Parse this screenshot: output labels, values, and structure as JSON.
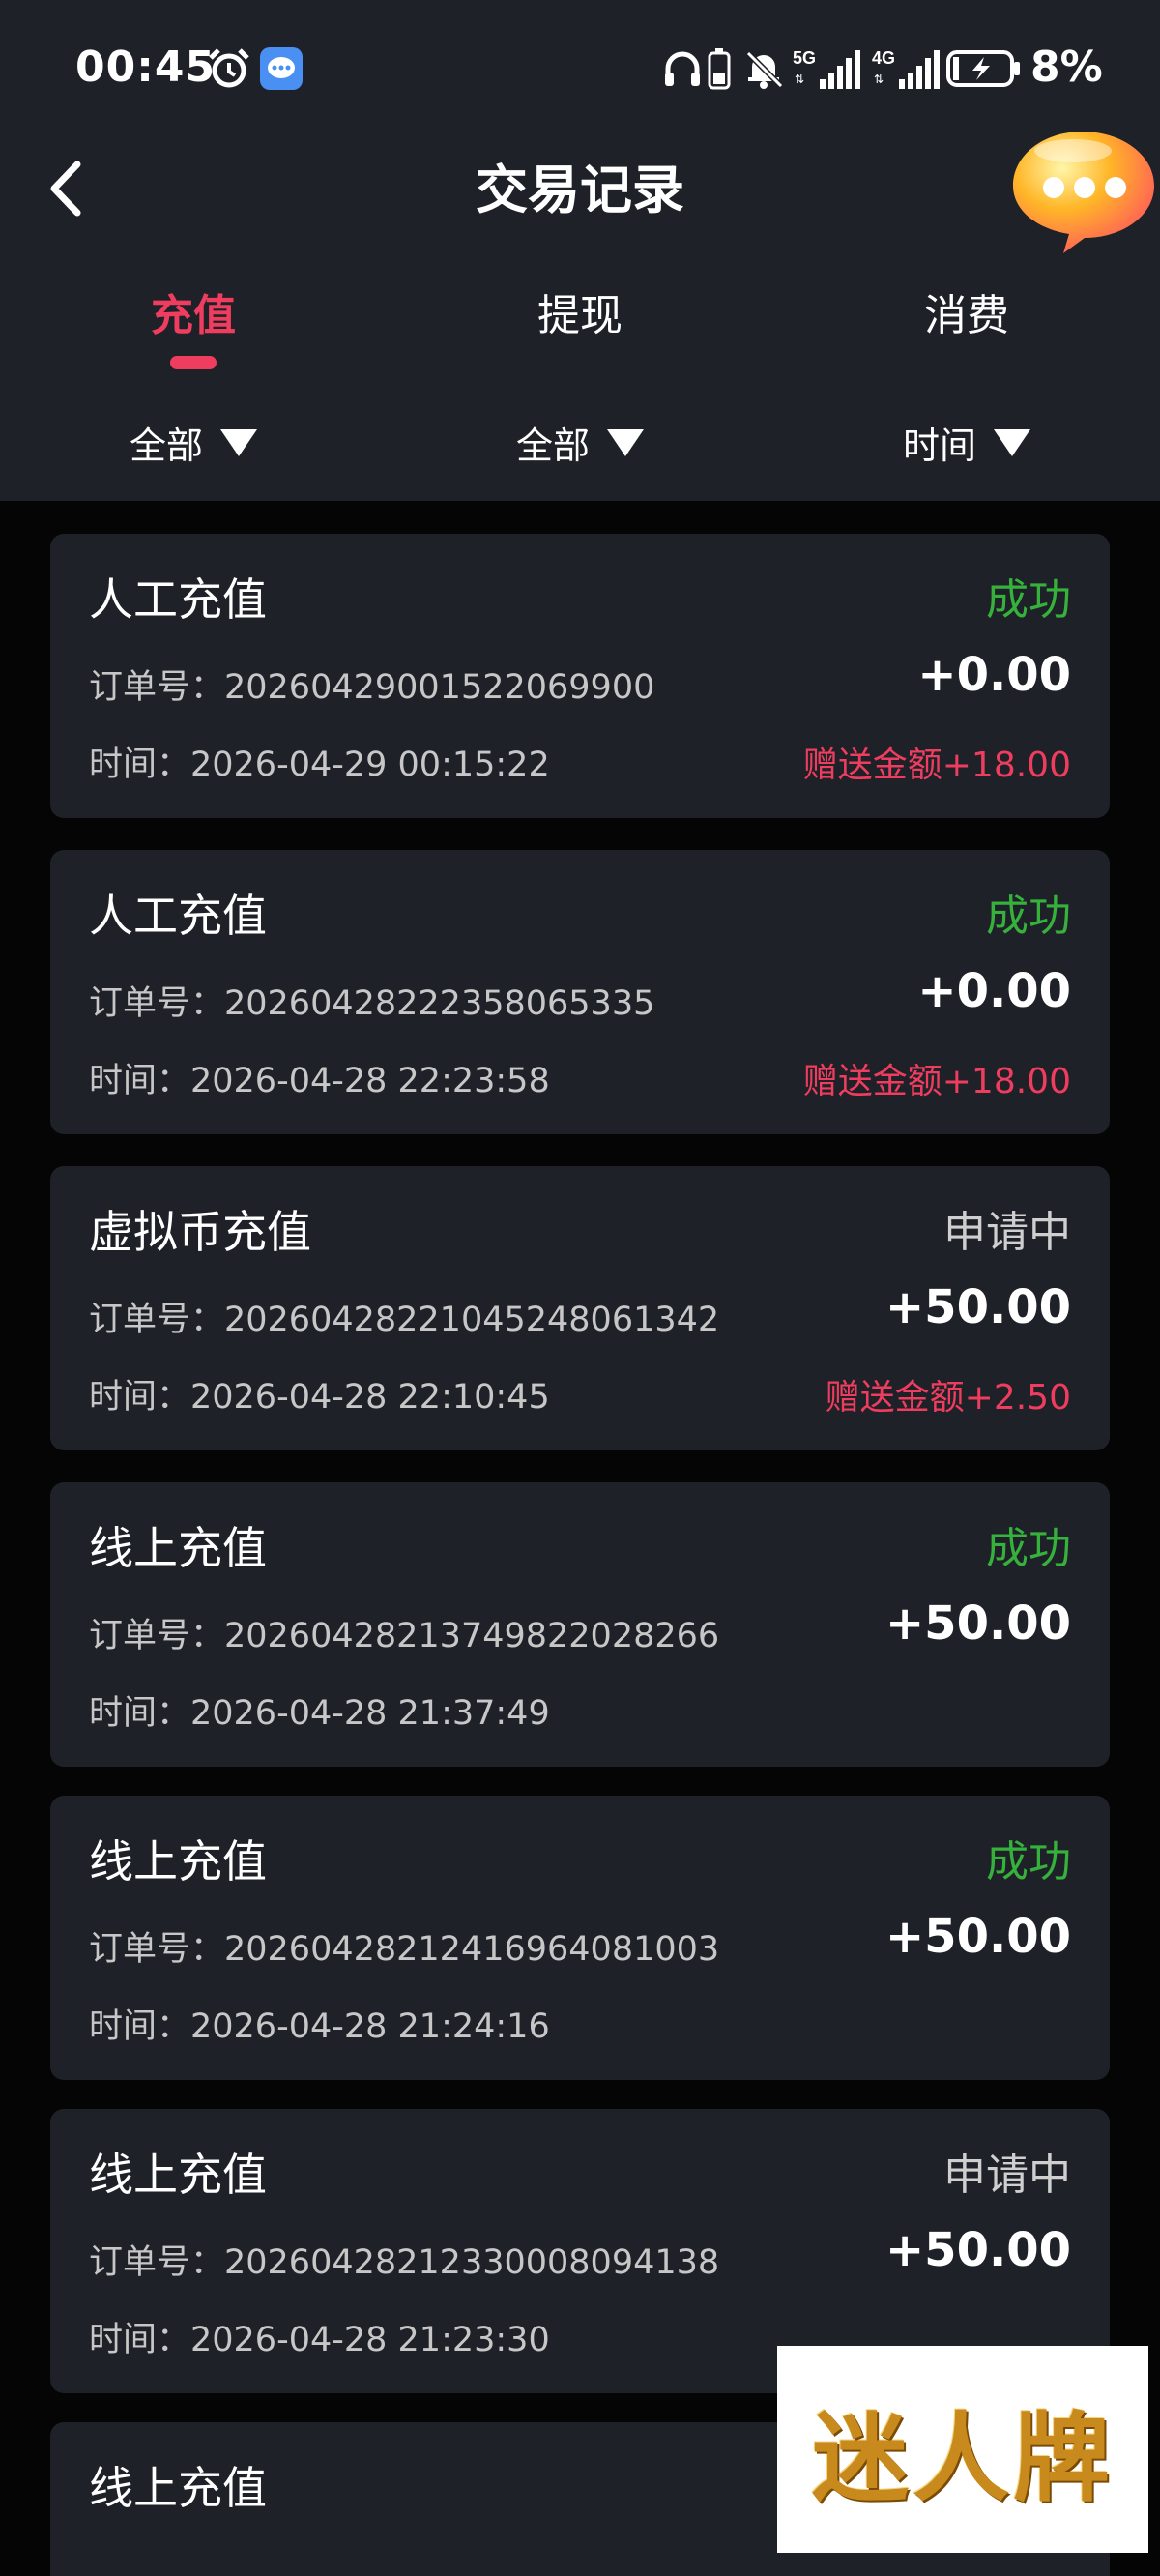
{
  "status_bar": {
    "time": "00:45",
    "icons": [
      "alarm-icon",
      "message-app-icon",
      "headphones-icon",
      "battery-small-icon",
      "mute-icon",
      "signal-5g-icon",
      "signal-4g-icon",
      "battery-charging-icon"
    ],
    "battery": "8%"
  },
  "header": {
    "title": "交易记录",
    "back_icon": "chevron-left-icon",
    "chat_icon": "chat-bubble-icon"
  },
  "tabs": [
    {
      "label": "充值",
      "active": true
    },
    {
      "label": "提现",
      "active": false
    },
    {
      "label": "消费",
      "active": false
    }
  ],
  "filters": [
    {
      "label": "全部"
    },
    {
      "label": "全部"
    },
    {
      "label": "时间"
    }
  ],
  "records": [
    {
      "type": "人工充值",
      "status": "成功",
      "status_kind": "success",
      "order": "订单号：20260429001522069900",
      "amount": "+0.00",
      "time": "时间：2026-04-29 00:15:22",
      "bonus": "赠送金额+18.00"
    },
    {
      "type": "人工充值",
      "status": "成功",
      "status_kind": "success",
      "order": "订单号：20260428222358065335",
      "amount": "+0.00",
      "time": "时间：2026-04-28 22:23:58",
      "bonus": "赠送金额+18.00"
    },
    {
      "type": "虚拟币充值",
      "status": "申请中",
      "status_kind": "pending",
      "order": "订单号：20260428221045248061342",
      "amount": "+50.00",
      "time": "时间：2026-04-28 22:10:45",
      "bonus": "赠送金额+2.50"
    },
    {
      "type": "线上充值",
      "status": "成功",
      "status_kind": "success",
      "order": "订单号：20260428213749822028266",
      "amount": "+50.00",
      "time": "时间：2026-04-28 21:37:49",
      "bonus": ""
    },
    {
      "type": "线上充值",
      "status": "成功",
      "status_kind": "success",
      "order": "订单号：20260428212416964081003",
      "amount": "+50.00",
      "time": "时间：2026-04-28 21:24:16",
      "bonus": ""
    },
    {
      "type": "线上充值",
      "status": "申请中",
      "status_kind": "pending",
      "order": "订单号：20260428212330008094138",
      "amount": "+50.00",
      "time": "时间：2026-04-28 21:23:30",
      "bonus": ""
    },
    {
      "type": "线上充值",
      "status": "",
      "status_kind": "",
      "order": "",
      "amount": "",
      "time": "",
      "bonus": ""
    }
  ],
  "watermark": {
    "text": "迷人牌"
  },
  "colors": {
    "accent": "#ee3d5e",
    "success": "#35b13c",
    "card_bg": "#1f2128",
    "page_bg": "#050505"
  }
}
